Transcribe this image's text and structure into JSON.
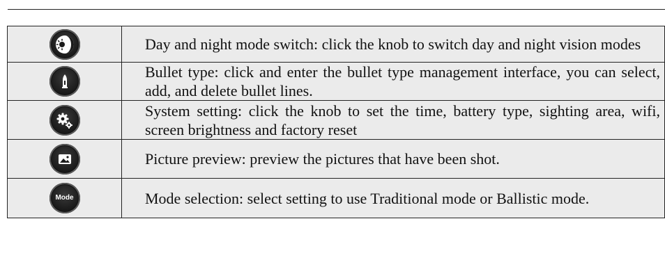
{
  "rows": [
    {
      "icon": "day-night-icon",
      "description": "Day and night mode switch: click the knob to switch day and night vision modes"
    },
    {
      "icon": "bullet-icon",
      "description": "Bullet type: click and enter the bullet type management interface, you can select, add, and delete bullet lines."
    },
    {
      "icon": "gears-icon",
      "description": "System setting: click the knob to set the time, battery type, sighting area, wifi, screen brightness and factory reset"
    },
    {
      "icon": "picture-icon",
      "description": "Picture preview: preview the pictures that have been shot."
    },
    {
      "icon": "mode-icon",
      "icon_label": "Mode",
      "description": "Mode selection: select setting to use Traditional mode or Ballistic mode."
    }
  ]
}
